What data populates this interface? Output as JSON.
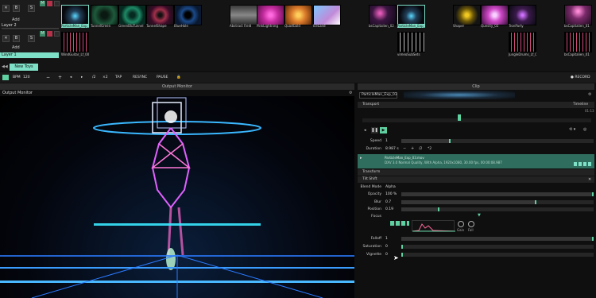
{
  "app": {
    "bg": "#0f0f0f",
    "accent": "#5fd0a0"
  },
  "layers": [
    {
      "name": "Layer 2",
      "add": "Add",
      "b": "B",
      "s": "S",
      "m": "M"
    },
    {
      "name": "Layer 1",
      "add": "Add",
      "b": "B",
      "s": "S",
      "m": "M"
    }
  ],
  "layer2_clips": [
    "ParticleMan_Exp_03",
    "TunnelGreen",
    "GreenBluTunnel",
    "TunnelShape",
    "BlueHole",
    "Abstract Field",
    "PinkLightning",
    "QuadGold",
    "IceLand",
    "bsCapitalien_02",
    "ParticleMan_Exp_03",
    "Shaper",
    "Quesity_02",
    "TronParty",
    "bsCapitalien_01"
  ],
  "layer1_clips": [
    "WindGuitar_Lf_001",
    "vimeoSubSets",
    "JungleDrums_Lf_001",
    "bsCapitalien_01"
  ],
  "new_toys": "New Toys",
  "toolbar": {
    "bpm_label": "BPM",
    "bpm_value": "120",
    "minus": "−",
    "plus": "+",
    "div2": "/2",
    "times2": "×2",
    "tap": "TAP",
    "resync": "RESYNC",
    "pause": "PAUSE",
    "record": "● RECORD"
  },
  "output_monitor": {
    "header": "Output Monitor",
    "title": "Output Monitor"
  },
  "clip_panel": {
    "header": "Clip",
    "clip_name": "ParticleMan_Exp_03"
  },
  "transport": {
    "label": "Transport",
    "mode": "Timeline",
    "time": "01:13",
    "speed_label": "Speed",
    "speed_value": "1",
    "duration_label": "Duration",
    "duration_value": "8.987 s",
    "minus": "−",
    "plus": "+",
    "div2": "/2",
    "times2": "*2"
  },
  "file_info": {
    "name": "ParticleMan_Exp_03.mov",
    "details": "DXV 3.0 Normal Quality, With Alpha, 1920x1080, 30.00 fps, 00:00:08.987"
  },
  "transform": {
    "label": "Transform"
  },
  "tilt_shift": {
    "label": "Tilt Shift",
    "blend_mode_label": "Blend Mode",
    "blend_mode_value": "Alpha",
    "params": [
      {
        "label": "Opacity",
        "value": "100 %"
      },
      {
        "label": "Blur",
        "value": "0.7"
      },
      {
        "label": "Position",
        "value": "0.19"
      }
    ],
    "focus_label": "Focus",
    "gain_label": "Gain",
    "fall_label": "Fall",
    "falloff_label": "Falloff",
    "falloff_value": "1",
    "saturation_label": "Saturation",
    "saturation_value": "0",
    "vignette_label": "Vignette",
    "vignette_value": "0"
  }
}
